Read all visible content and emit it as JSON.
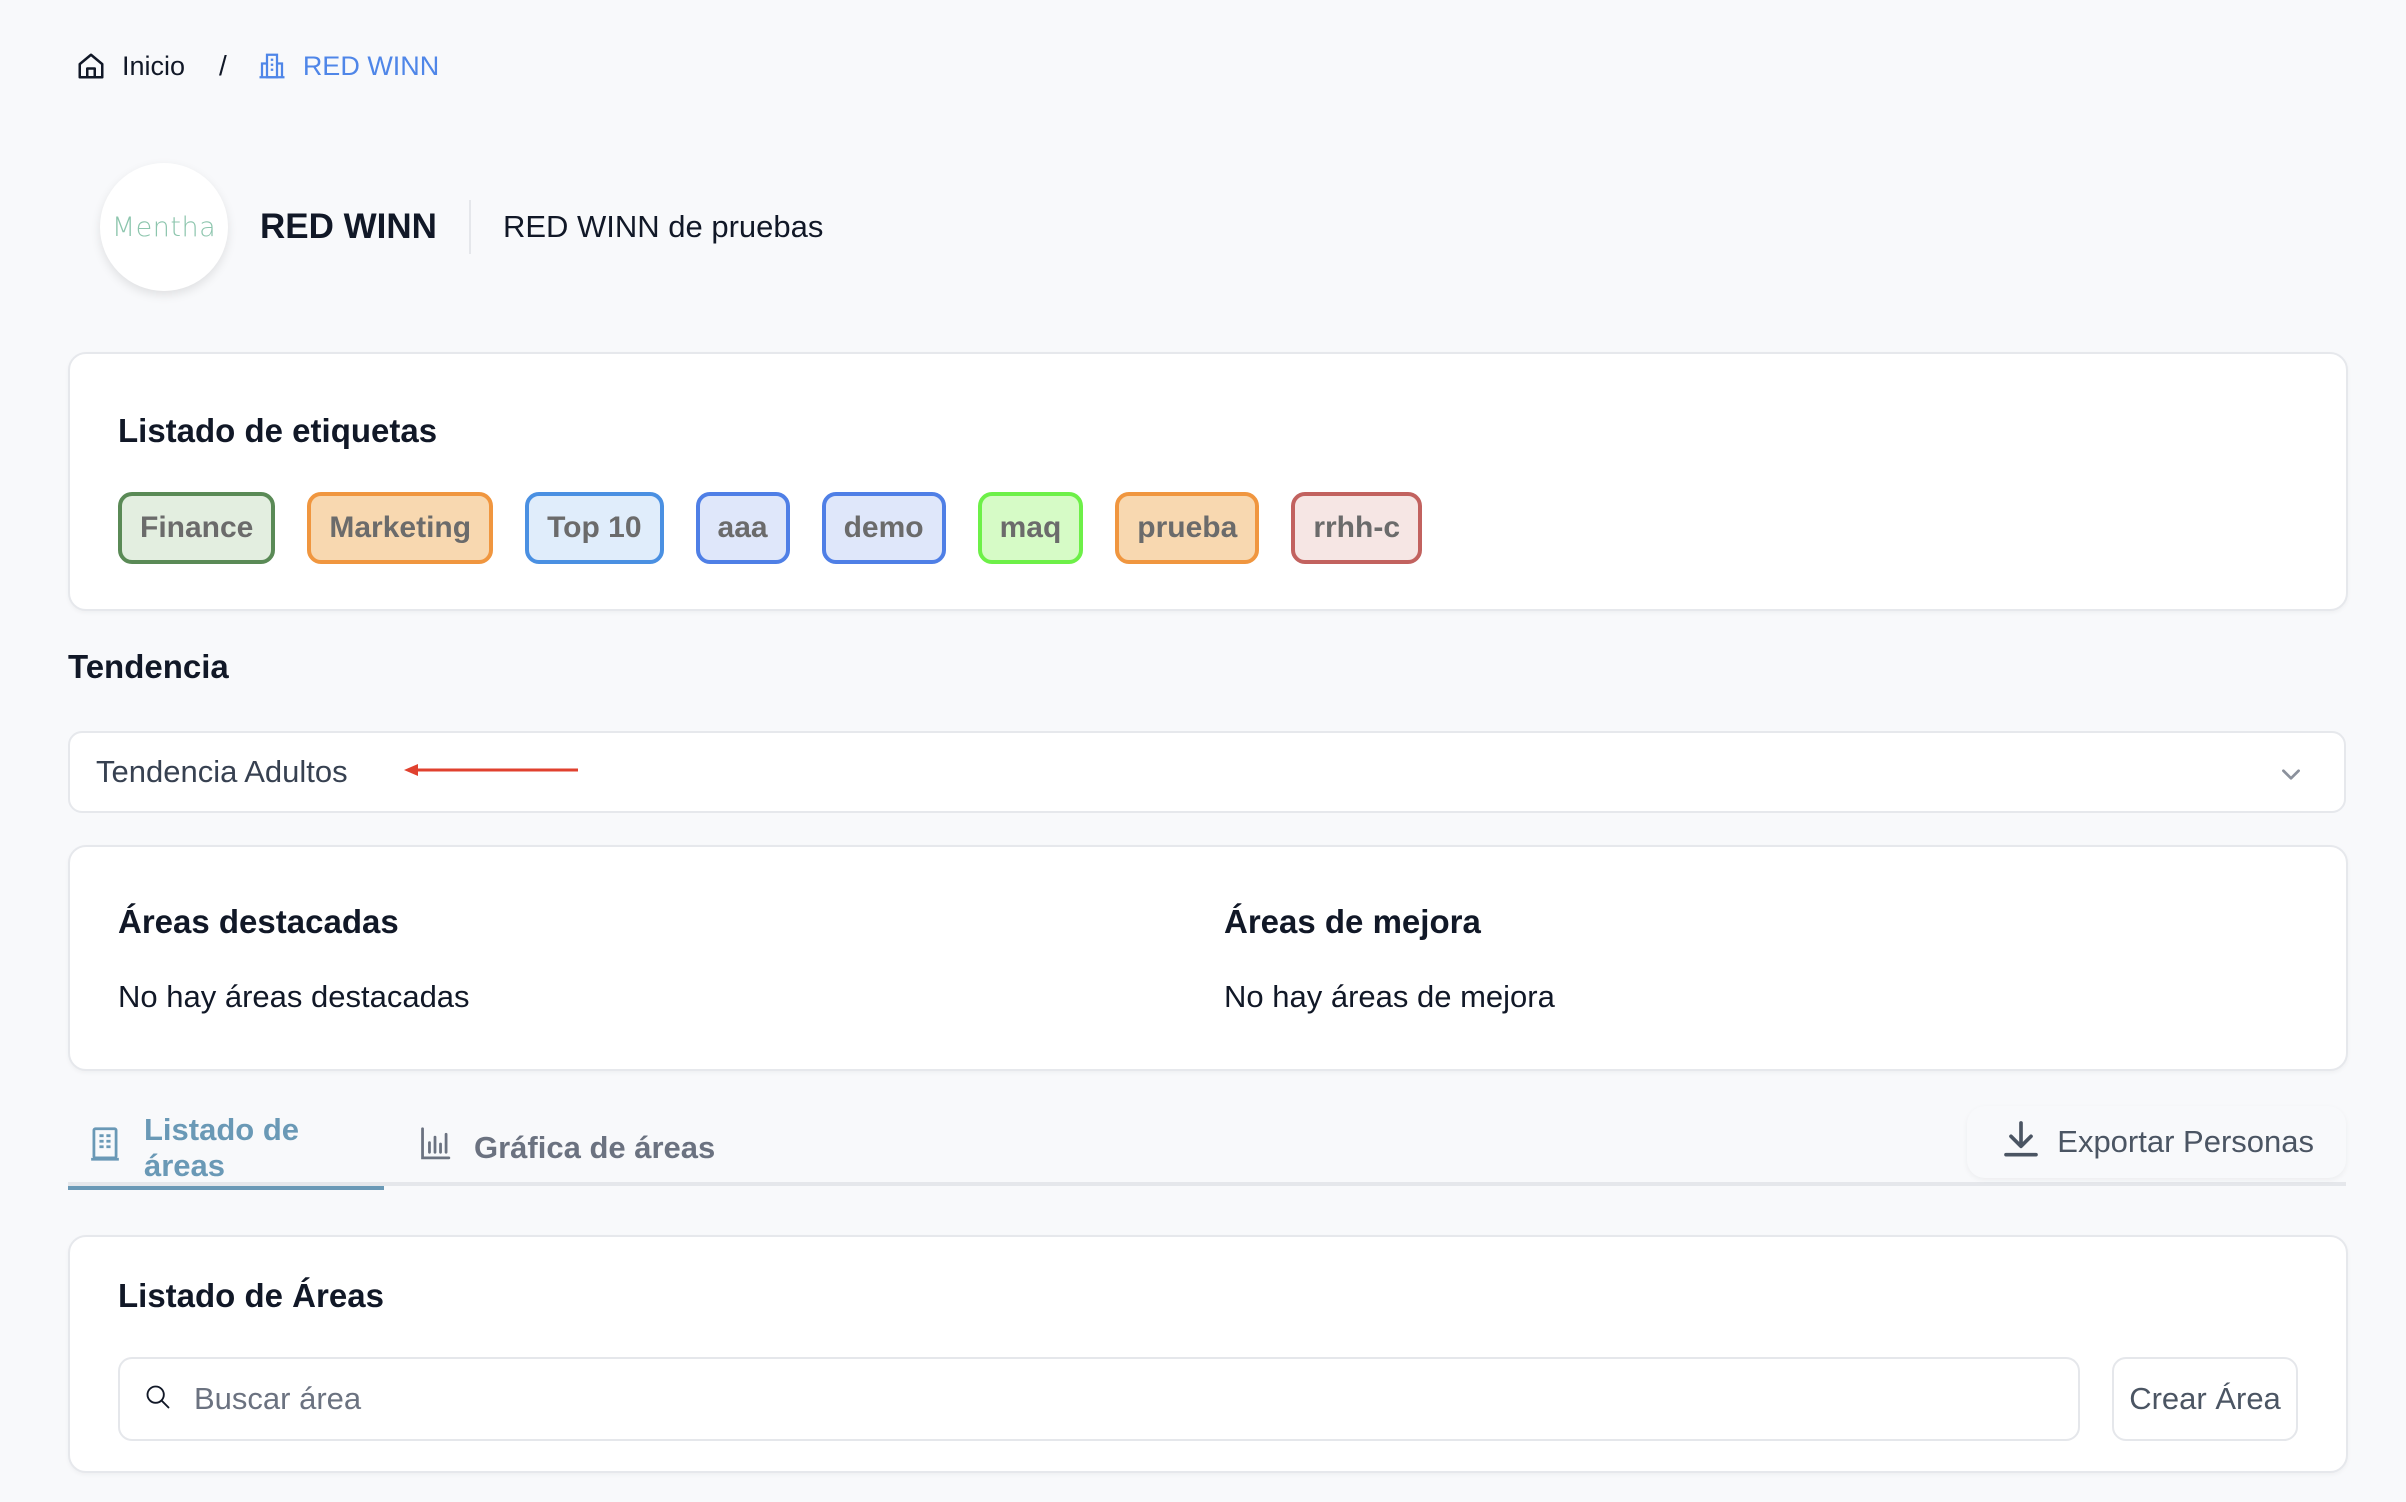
{
  "breadcrumb": {
    "home_label": "Inicio",
    "separator": "/",
    "current_label": "RED WINN",
    "home_icon": "home-icon",
    "current_icon": "building-icon"
  },
  "header": {
    "logo_text": "Mentha",
    "org_name": "RED WINN",
    "org_description": "RED WINN de pruebas"
  },
  "tags_card": {
    "title": "Listado de etiquetas",
    "tags": [
      {
        "label": "Finance",
        "border": "#5a8a56",
        "bg": "#e3eee0"
      },
      {
        "label": "Marketing",
        "border": "#f0963f",
        "bg": "#f8d8b0"
      },
      {
        "label": "Top 10",
        "border": "#4a90e2",
        "bg": "#e0edfb"
      },
      {
        "label": "aaa",
        "border": "#4f7fe6",
        "bg": "#dfe7fa"
      },
      {
        "label": "demo",
        "border": "#4f7fe6",
        "bg": "#dfe7fa"
      },
      {
        "label": "maq",
        "border": "#6df048",
        "bg": "#d6fbc6"
      },
      {
        "label": "prueba",
        "border": "#f0963f",
        "bg": "#f8d8b0"
      },
      {
        "label": "rrhh-c",
        "border": "#c2625f",
        "bg": "#f6e6e4"
      }
    ]
  },
  "trend": {
    "heading": "Tendencia",
    "selected": "Tendencia Adultos",
    "annotation_color": "#e0412f"
  },
  "areas": {
    "highlighted_title": "Áreas destacadas",
    "highlighted_empty": "No hay áreas destacadas",
    "improvement_title": "Áreas de mejora",
    "improvement_empty": "No hay áreas de mejora"
  },
  "tabs": {
    "items": [
      {
        "label": "Listado de áreas",
        "icon": "building-list-icon",
        "active": true
      },
      {
        "label": "Gráfica de áreas",
        "icon": "bar-chart-icon",
        "active": false
      }
    ],
    "export_label": "Exportar Personas",
    "export_icon": "download-icon"
  },
  "areas_list": {
    "title": "Listado de Áreas",
    "search_placeholder": "Buscar área",
    "search_value": "",
    "create_label": "Crear Área"
  },
  "colors": {
    "accent_link": "#4f86e8",
    "active_tab": "#6a99b6"
  }
}
